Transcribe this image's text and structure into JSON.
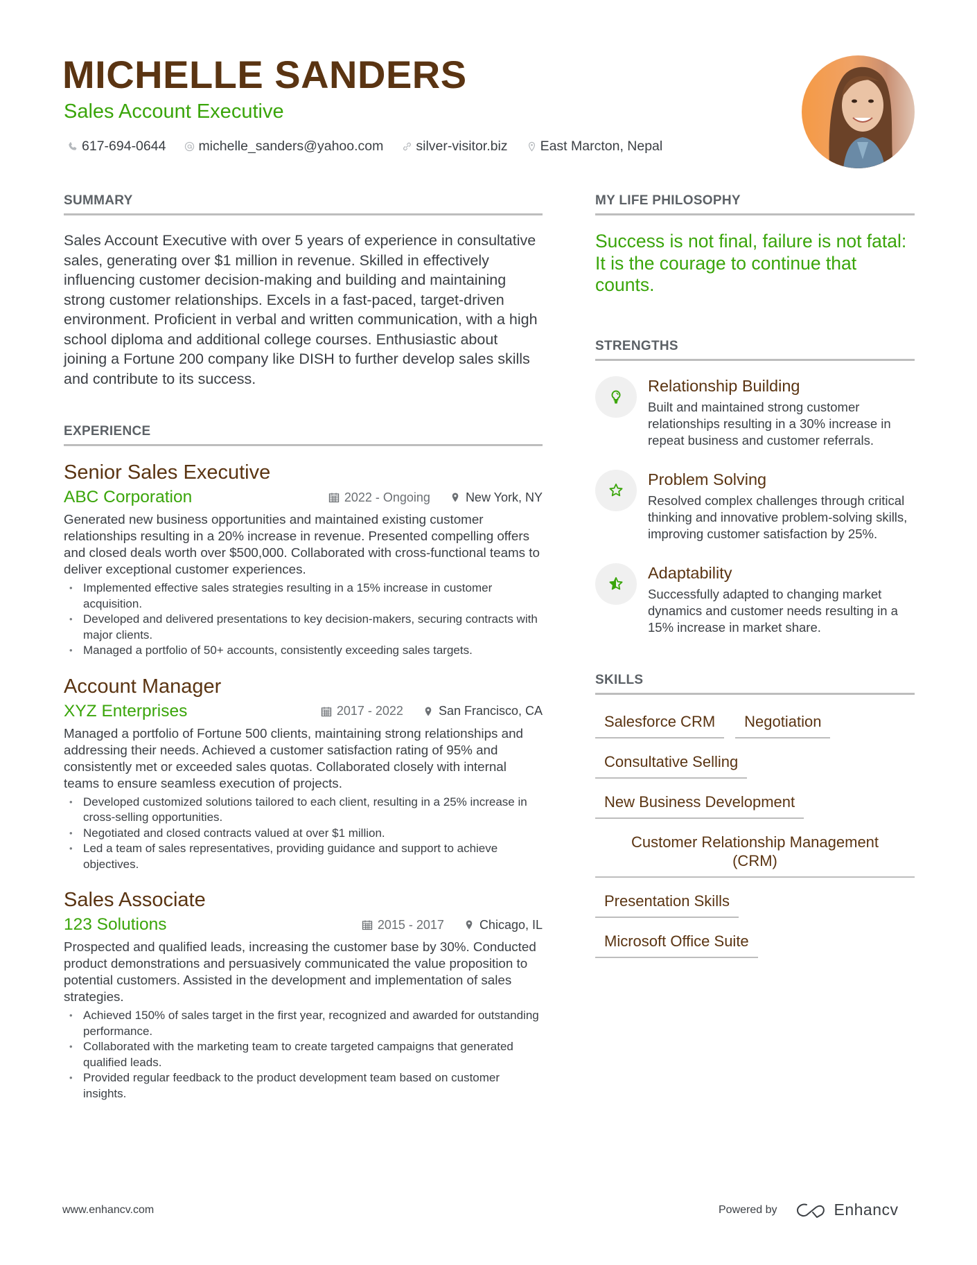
{
  "header": {
    "name": "MICHELLE SANDERS",
    "title": "Sales Account Executive",
    "contacts": [
      {
        "icon": "phone-icon",
        "text": "617-694-0644"
      },
      {
        "icon": "at-icon",
        "text": "michelle_sanders@yahoo.com"
      },
      {
        "icon": "link-icon",
        "text": "silver-visitor.biz"
      },
      {
        "icon": "location-pin-icon",
        "text": "East Marcton, Nepal"
      }
    ]
  },
  "summary": {
    "heading": "SUMMARY",
    "text": "Sales Account Executive with over 5 years of experience in consultative sales, generating over $1 million in revenue. Skilled in effectively influencing customer decision-making and building and maintaining strong customer relationships. Excels in a fast-paced, target-driven environment. Proficient in verbal and written communication, with a high school diploma and additional college courses. Enthusiastic about joining a Fortune 200 company like DISH to further develop sales skills and contribute to its success."
  },
  "experience": {
    "heading": "EXPERIENCE",
    "jobs": [
      {
        "title": "Senior Sales Executive",
        "company": "ABC Corporation",
        "dates": "2022 - Ongoing",
        "location": "New York, NY",
        "description": "Generated new business opportunities and maintained existing customer relationships resulting in a 20% increase in revenue. Presented compelling offers and closed deals worth over $500,000. Collaborated with cross-functional teams to deliver exceptional customer experiences.",
        "bullets": [
          "Implemented effective sales strategies resulting in a 15% increase in customer acquisition.",
          "Developed and delivered presentations to key decision-makers, securing contracts with major clients.",
          "Managed a portfolio of 50+ accounts, consistently exceeding sales targets."
        ]
      },
      {
        "title": "Account Manager",
        "company": "XYZ Enterprises",
        "dates": "2017 - 2022",
        "location": "San Francisco, CA",
        "description": "Managed a portfolio of Fortune 500 clients, maintaining strong relationships and addressing their needs. Achieved a customer satisfaction rating of 95% and consistently met or exceeded sales quotas. Collaborated closely with internal teams to ensure seamless execution of projects.",
        "bullets": [
          "Developed customized solutions tailored to each client, resulting in a 25% increase in cross-selling opportunities.",
          "Negotiated and closed contracts valued at over $1 million.",
          "Led a team of sales representatives, providing guidance and support to achieve objectives."
        ]
      },
      {
        "title": "Sales Associate",
        "company": "123 Solutions",
        "dates": "2015 - 2017",
        "location": "Chicago, IL",
        "description": "Prospected and qualified leads, increasing the customer base by 30%. Conducted product demonstrations and persuasively communicated the value proposition to potential customers. Assisted in the development and implementation of sales strategies.",
        "bullets": [
          "Achieved 150% of sales target in the first year, recognized and awarded for outstanding performance.",
          "Collaborated with the marketing team to create targeted campaigns that generated qualified leads.",
          "Provided regular feedback to the product development team based on customer insights."
        ]
      }
    ]
  },
  "philosophy": {
    "heading": "MY LIFE PHILOSOPHY",
    "quote": "Success is not final, failure is not fatal: It is the courage to continue that counts."
  },
  "strengths": {
    "heading": "STRENGTHS",
    "items": [
      {
        "icon": "lightbulb-icon",
        "title": "Relationship Building",
        "description": "Built and maintained strong customer relationships resulting in a 30% increase in repeat business and customer referrals."
      },
      {
        "icon": "star-icon",
        "title": "Problem Solving",
        "description": "Resolved complex challenges through critical thinking and innovative problem-solving skills, improving customer satisfaction by 25%."
      },
      {
        "icon": "half-star-icon",
        "title": "Adaptability",
        "description": "Successfully adapted to changing market dynamics and customer needs resulting in a 15% increase in market share."
      }
    ]
  },
  "skills": {
    "heading": "SKILLS",
    "items": [
      "Salesforce CRM",
      "Negotiation",
      "Consultative Selling",
      "New Business Development",
      "Customer Relationship Management (CRM)",
      "Presentation Skills",
      "Microsoft Office Suite"
    ]
  },
  "footer": {
    "website": "www.enhancv.com",
    "powered_by": "Powered by",
    "brand": "Enhancv"
  },
  "colors": {
    "name": "#5a3412",
    "accent": "#3aa50a",
    "text": "#3b3f44",
    "rule": "#bdbdbd"
  }
}
